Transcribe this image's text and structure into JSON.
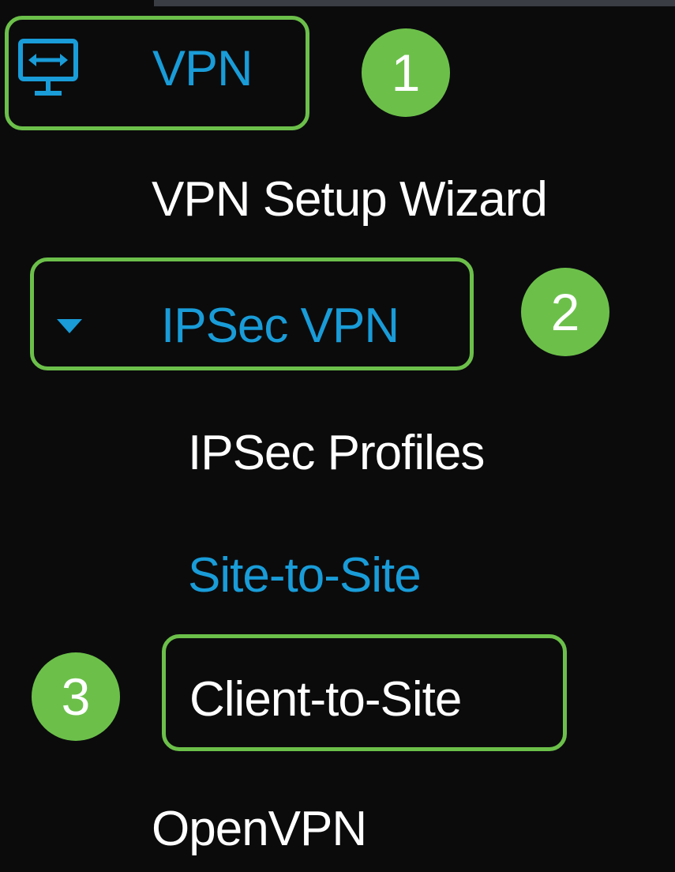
{
  "nav": {
    "vpn": {
      "label": "VPN",
      "icon": "vpn-monitor-icon"
    },
    "vpn_setup_wizard": {
      "label": "VPN Setup Wizard"
    },
    "ipsec_vpn": {
      "label": "IPSec VPN",
      "icon": "caret-down-icon",
      "expanded": true
    },
    "ipsec_profiles": {
      "label": "IPSec Profiles"
    },
    "site_to_site": {
      "label": "Site-to-Site",
      "active": true
    },
    "client_to_site": {
      "label": "Client-to-Site"
    },
    "openvpn": {
      "label": "OpenVPN"
    }
  },
  "steps": [
    {
      "number": "1"
    },
    {
      "number": "2"
    },
    {
      "number": "3"
    }
  ],
  "colors": {
    "background": "#0b0b0c",
    "accent_blue": "#199cd8",
    "highlight_green": "#6cc04a",
    "text_white": "#ffffff"
  }
}
